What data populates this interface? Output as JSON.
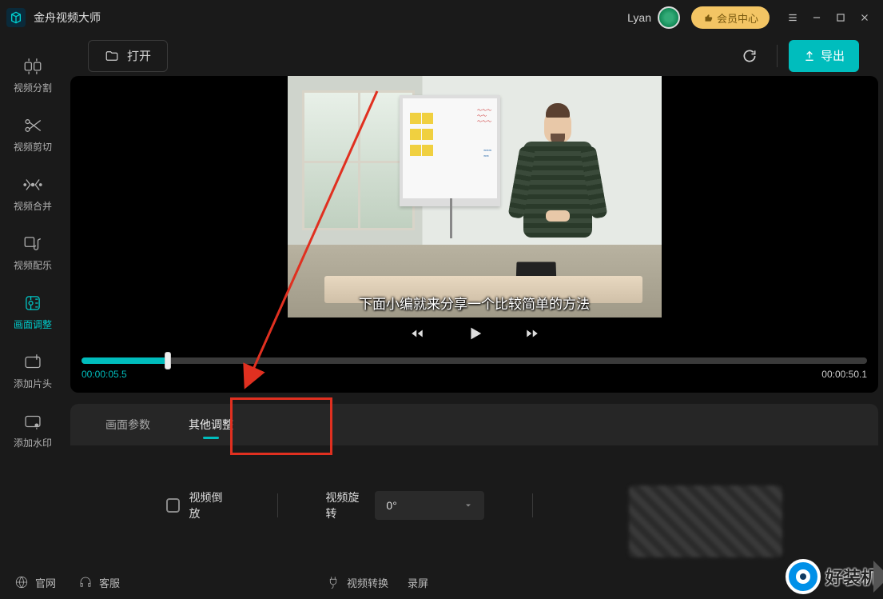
{
  "titlebar": {
    "app_name": "金舟视频大师",
    "user": "Lyan",
    "vip_label": "会员中心"
  },
  "nav": {
    "items": [
      {
        "label": "视频分割"
      },
      {
        "label": "视频剪切"
      },
      {
        "label": "视频合并"
      },
      {
        "label": "视频配乐"
      },
      {
        "label": "画面调整"
      },
      {
        "label": "添加片头"
      },
      {
        "label": "添加水印"
      }
    ],
    "active_index": 4
  },
  "toolbar": {
    "open_label": "打开",
    "export_label": "导出"
  },
  "player": {
    "subtitle_text": "下面小编就来分享一个比较简单的方法",
    "current_time": "00:00:05.5",
    "duration": "00:00:50.1",
    "progress_percent": 11
  },
  "tabs": {
    "items": [
      {
        "label": "画面参数"
      },
      {
        "label": "其他调整"
      }
    ],
    "active_index": 1
  },
  "adjust": {
    "reverse_label": "视频倒放",
    "rotate_label": "视频旋转",
    "rotate_value": "0°"
  },
  "footer": {
    "site_label": "官网",
    "support_label": "客服",
    "convert_label": "视频转换",
    "record_label": "录屏"
  },
  "corner_logo_text": "好装机"
}
